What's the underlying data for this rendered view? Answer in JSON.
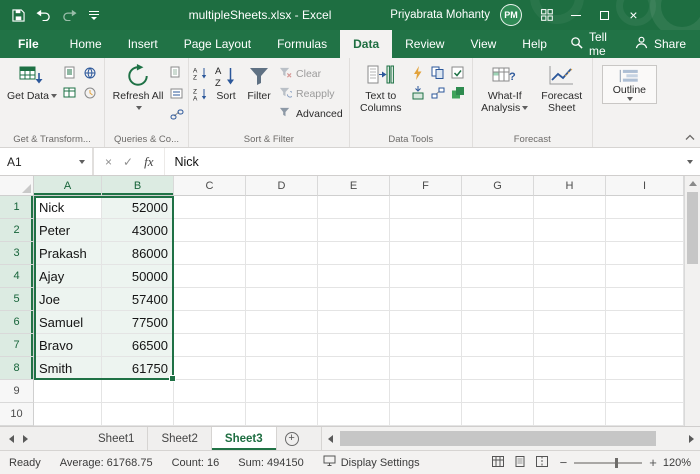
{
  "titlebar": {
    "title": "multipleSheets.xlsx  -  Excel",
    "user_name": "Priyabrata Mohanty",
    "avatar_initials": "PM"
  },
  "ribbon": {
    "tabs": [
      "File",
      "Home",
      "Insert",
      "Page Layout",
      "Formulas",
      "Data",
      "Review",
      "View",
      "Help"
    ],
    "active_tab": "Data",
    "tell_me_label": "Tell me",
    "share_label": "Share",
    "groups": {
      "get_transform": {
        "label": "Get & Transform...",
        "get_data_label": "Get Data"
      },
      "queries": {
        "label": "Queries & Co...",
        "refresh_all_label": "Refresh All"
      },
      "sort_filter": {
        "label": "Sort & Filter",
        "sort_label": "Sort",
        "filter_label": "Filter",
        "clear_label": "Clear",
        "reapply_label": "Reapply",
        "advanced_label": "Advanced"
      },
      "data_tools": {
        "label": "Data Tools",
        "text_to_columns_label": "Text to Columns"
      },
      "forecast": {
        "label": "Forecast",
        "what_if_label": "What-If Analysis",
        "forecast_sheet_label": "Forecast Sheet"
      },
      "outline": {
        "outline_label": "Outline"
      }
    }
  },
  "formula_bar": {
    "name_box": "A1",
    "content": "Nick"
  },
  "grid": {
    "column_headers": [
      "A",
      "B",
      "C",
      "D",
      "E",
      "F",
      "G",
      "H",
      "I"
    ],
    "row_count": 10,
    "data_rows": [
      [
        "Nick",
        "52000"
      ],
      [
        "Peter",
        "43000"
      ],
      [
        "Prakash",
        "86000"
      ],
      [
        "Ajay",
        "50000"
      ],
      [
        "Joe",
        "57400"
      ],
      [
        "Samuel",
        "77500"
      ],
      [
        "Bravo",
        "66500"
      ],
      [
        "Smith",
        "61750"
      ]
    ],
    "selection": {
      "range": "A1:B8",
      "active_cell": "A1"
    }
  },
  "sheet_bar": {
    "tabs": [
      "Sheet1",
      "Sheet2",
      "Sheet3"
    ],
    "active_tab": "Sheet3"
  },
  "status_bar": {
    "mode": "Ready",
    "average": "Average: 61768.75",
    "count": "Count: 16",
    "sum": "Sum: 494150",
    "display_settings_label": "Display Settings",
    "zoom_percent": "120%"
  }
}
